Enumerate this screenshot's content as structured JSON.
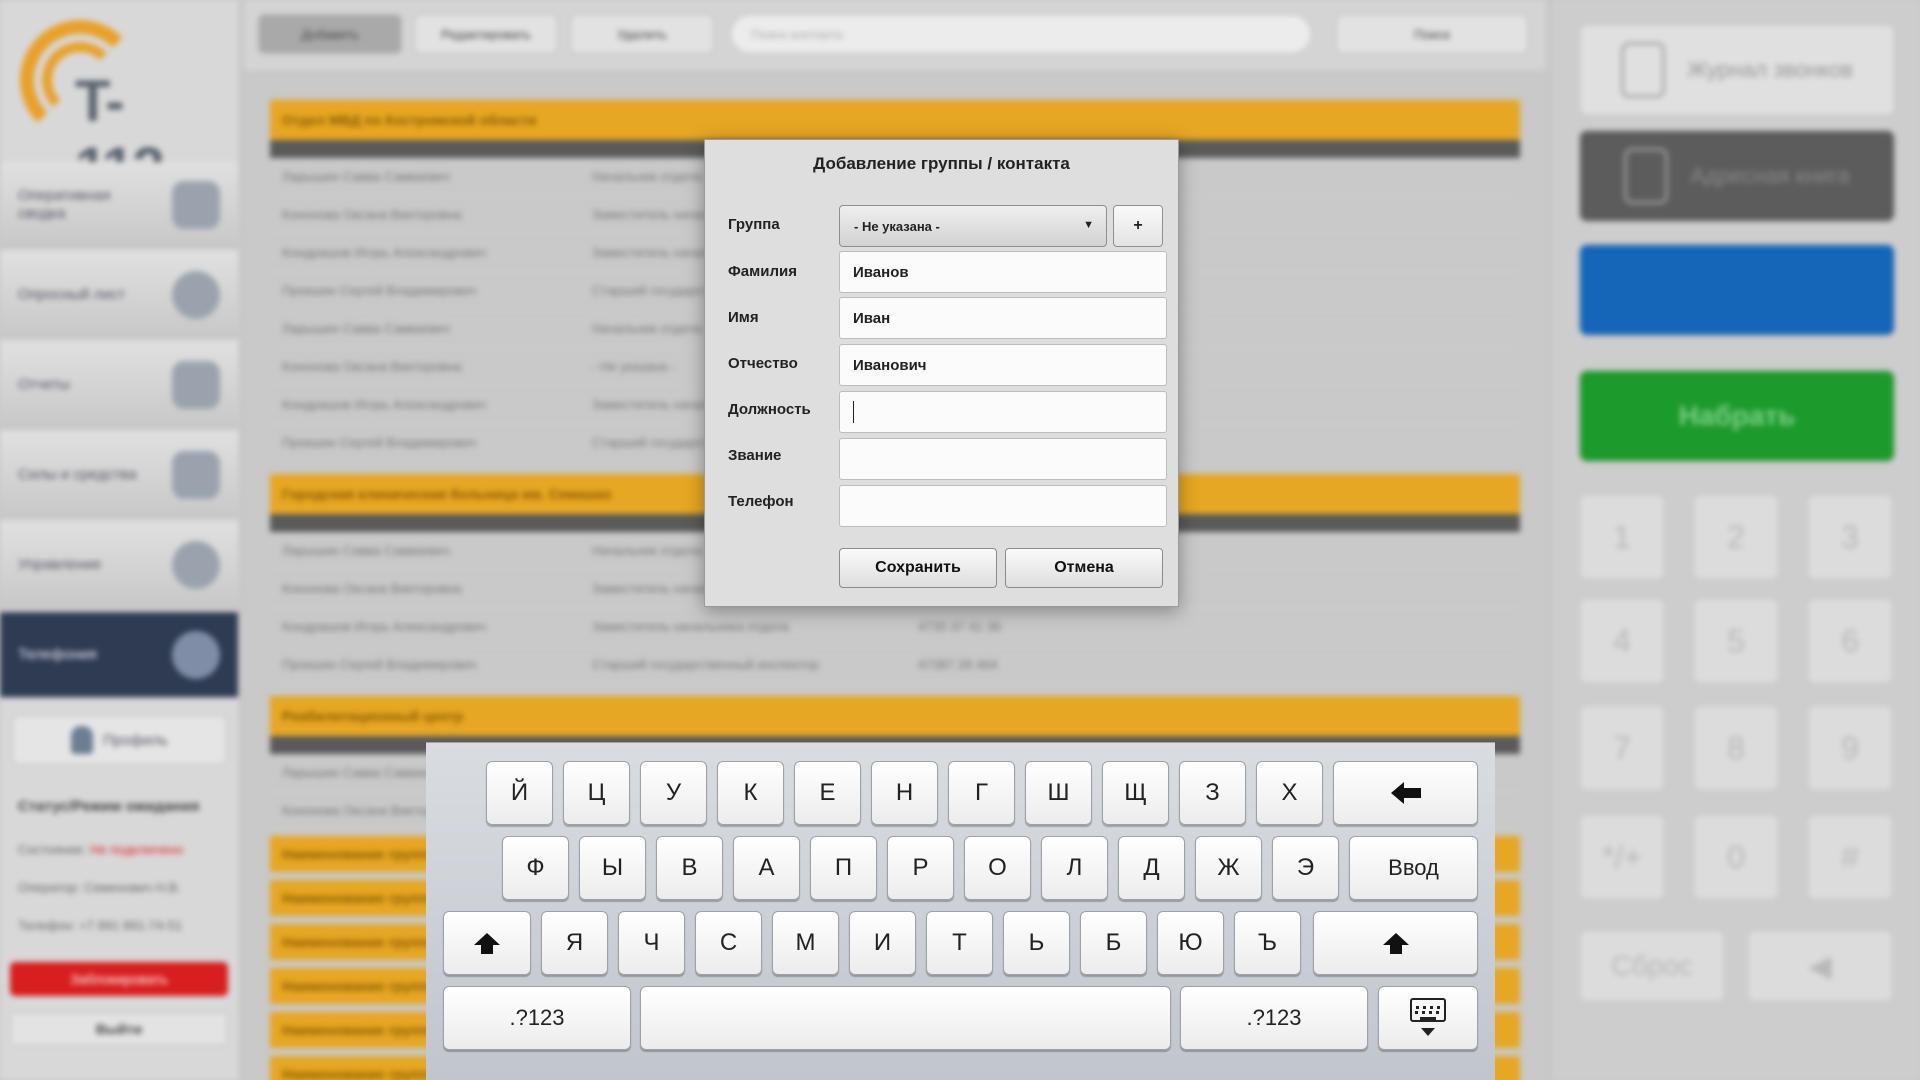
{
  "app": {
    "logo_text": "T-112",
    "nav": [
      {
        "label": "Оперативная сводка"
      },
      {
        "label": "Опросный лист"
      },
      {
        "label": "Отчеты"
      },
      {
        "label": "Силы и средства"
      },
      {
        "label": "Управление"
      },
      {
        "label": "Телефония"
      }
    ],
    "profile_label": "Профиль",
    "status_title": "Статус/Режим ожидания",
    "status_state_label": "Состояние:",
    "status_state_value": "Не подключено",
    "status_operator_label": "Оператор:",
    "status_operator_value": "Семенович Н.В.",
    "status_phone_label": "Телефон:",
    "status_phone_value": "+7 891 891-74-51",
    "block_label": "Заблокировать",
    "exit_label": "Выйти",
    "toolbar": {
      "add": "Добавить",
      "edit": "Редактировать",
      "delete": "Удалить",
      "search_placeholder": "Поиск контакта",
      "search_button": "Поиск"
    },
    "groups": [
      {
        "name": "Отдел МВД по Костромской области",
        "rows": [
          [
            "Ларышин Савва Савваевич",
            "Начальник отдела",
            ""
          ],
          [
            "Кононова Оксана Викторовна",
            "Заместитель начальника отдела",
            ""
          ],
          [
            "Кондрашов Игорь Александрович",
            "Заместитель начальника отдела",
            ""
          ],
          [
            "Прокшин Сергей Владимирович",
            "Старший государственный инспектор",
            ""
          ],
          [
            "Ларышин Савва Савваевич",
            "Начальник отдела",
            ""
          ],
          [
            "Кононова Оксана Викторовна",
            "- Не указана -",
            ""
          ],
          [
            "Кондрашов Игорь Александрович",
            "Заместитель начальника отдела",
            ""
          ],
          [
            "Прокшин Сергей Владимирович",
            "Старший государственный инспектор",
            ""
          ]
        ]
      },
      {
        "name": "Городская клиническая больница им. Семашко",
        "rows": [
          [
            "Ларышин Савва Савваевич",
            "Начальник отдела",
            ""
          ],
          [
            "Кононова Оксана Викторовна",
            "Заместитель начальника отдела",
            ""
          ],
          [
            "Кондрашов Игорь Александрович",
            "Заместитель начальника отдела",
            "4735 37 41 36"
          ],
          [
            "Прокшин Сергей Владимирович",
            "Старший государственный инспектор",
            "47387 28 464"
          ]
        ]
      },
      {
        "name": "Реабилитационный центр",
        "rows": [
          [
            "Ларышин Савва Савваевич",
            "",
            ""
          ],
          [
            "Кононова Оксана Викторовна",
            "",
            ""
          ]
        ]
      }
    ],
    "collapsed_groups": [
      "Наименование группы",
      "Наименование группы",
      "Наименование группы",
      "Наименование группы",
      "Наименование группы",
      "Наименование группы"
    ],
    "right": {
      "call_log": "Журнал звонков",
      "address_book": "Адресная книга",
      "dial": "Набрать",
      "keys": [
        "1",
        "2",
        "3",
        "4",
        "5",
        "6",
        "7",
        "8",
        "9",
        "*/+",
        "0",
        "#"
      ],
      "reset": "Сброс"
    }
  },
  "dialog": {
    "title": "Добавление группы / контакта",
    "group_label": "Группа",
    "group_value": "- Не указана -",
    "add_group_label": "+",
    "last_name_label": "Фамилия",
    "last_name_value": "Иванов",
    "first_name_label": "Имя",
    "first_name_value": "Иван",
    "patronymic_label": "Отчество",
    "patronymic_value": "Иванович",
    "position_label": "Должность",
    "position_value": "",
    "rank_label": "Звание",
    "rank_value": "",
    "phone_label": "Телефон",
    "phone_value": "",
    "save_label": "Сохранить",
    "cancel_label": "Отмена"
  },
  "keyboard": {
    "row1": [
      "Й",
      "Ц",
      "У",
      "К",
      "Е",
      "Н",
      "Г",
      "Ш",
      "Щ",
      "З",
      "Х"
    ],
    "row2": [
      "Ф",
      "Ы",
      "В",
      "А",
      "П",
      "Р",
      "О",
      "Л",
      "Д",
      "Ж",
      "Э"
    ],
    "row3": [
      "Я",
      "Ч",
      "С",
      "М",
      "И",
      "Т",
      "Ь",
      "Б",
      "Ю",
      "Ъ"
    ],
    "enter_label": "Ввод",
    "numbers_label": ".?123"
  }
}
